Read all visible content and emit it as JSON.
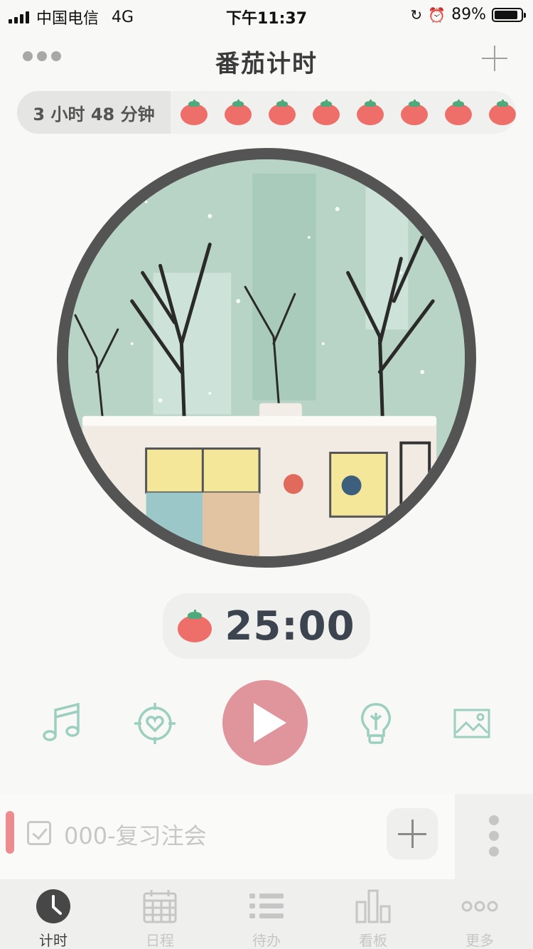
{
  "status_bar": {
    "carrier": "中国电信",
    "network": "4G",
    "time": "下午11:37",
    "battery_percent": "89%",
    "battery_level": 0.89
  },
  "header": {
    "title": "番茄计时",
    "menu_icon": "more-dots-icon",
    "add_icon": "plus-icon"
  },
  "summary": {
    "total_time": "3 小时  48 分钟",
    "tomato_count": 8
  },
  "timer": {
    "value": "25:00"
  },
  "controls": {
    "icons": [
      "music-note-icon",
      "target-heart-icon",
      "play-icon",
      "lightbulb-icon",
      "image-icon"
    ]
  },
  "task": {
    "label": "000-复习注会",
    "accent_color": "#ec8c8e"
  },
  "tabs": [
    {
      "label": "计时",
      "icon": "clock-icon",
      "active": true
    },
    {
      "label": "日程",
      "icon": "calendar-icon",
      "active": false
    },
    {
      "label": "待办",
      "icon": "list-icon",
      "active": false
    },
    {
      "label": "看板",
      "icon": "chart-board-icon",
      "active": false
    },
    {
      "label": "更多",
      "icon": "more-icon",
      "active": false
    }
  ],
  "colors": {
    "tomato": "#ee6f6a",
    "leaf": "#4fa97b",
    "play": "#e0959c",
    "icon_mint": "#9ccfc0"
  }
}
